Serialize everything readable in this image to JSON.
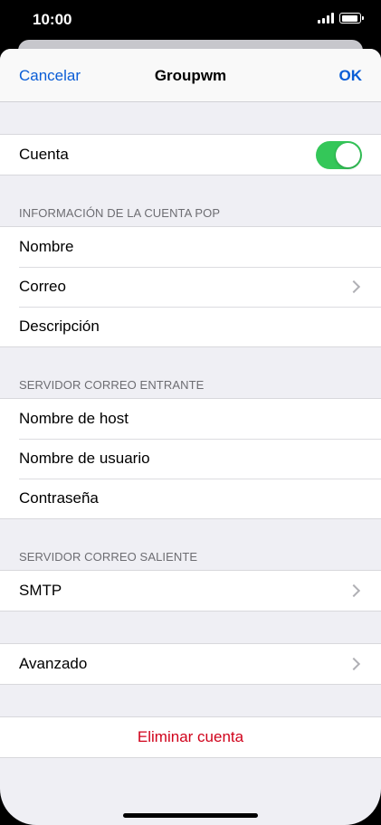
{
  "status": {
    "time": "10:00"
  },
  "nav": {
    "cancel": "Cancelar",
    "title": "Groupwm",
    "ok": "OK"
  },
  "account": {
    "label": "Cuenta",
    "enabled": true
  },
  "pop_section": {
    "header": "INFORMACIÓN DE LA CUENTA POP",
    "items": [
      "Nombre",
      "Correo",
      "Descripción"
    ]
  },
  "incoming_section": {
    "header": "SERVIDOR CORREO ENTRANTE",
    "items": [
      "Nombre de host",
      "Nombre de usuario",
      "Contraseña"
    ]
  },
  "outgoing_section": {
    "header": "SERVIDOR CORREO SALIENTE",
    "items": [
      "SMTP"
    ]
  },
  "advanced": {
    "label": "Avanzado"
  },
  "delete": {
    "label": "Eliminar cuenta"
  },
  "colors": {
    "accent": "#0a5dd6",
    "toggle_on": "#34c759",
    "destructive": "#d0021b"
  },
  "icons": [
    "signal-icon",
    "battery-icon",
    "chevron-right-icon"
  ]
}
